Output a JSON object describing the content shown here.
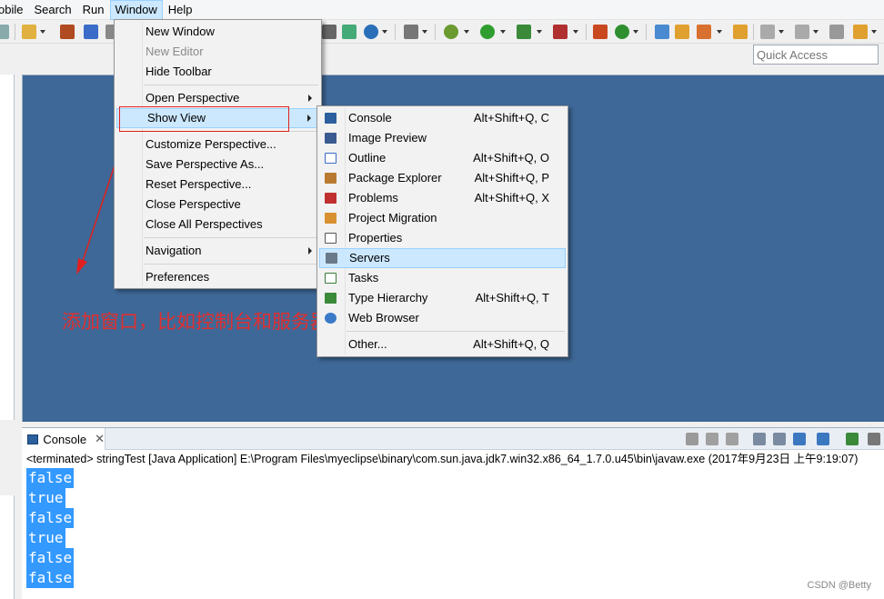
{
  "menubar": {
    "items": [
      "obile",
      "Search",
      "Run",
      "Window",
      "Help"
    ]
  },
  "quick_access": {
    "placeholder": "Quick Access"
  },
  "window_menu": {
    "new_window": "New Window",
    "new_editor": "New Editor",
    "hide_toolbar": "Hide Toolbar",
    "open_perspective": "Open Perspective",
    "show_view": "Show View",
    "customize_perspective": "Customize Perspective...",
    "save_perspective_as": "Save Perspective As...",
    "reset_perspective": "Reset Perspective...",
    "close_perspective": "Close Perspective",
    "close_all_perspectives": "Close All Perspectives",
    "navigation": "Navigation",
    "preferences": "Preferences"
  },
  "show_view_menu": {
    "items": [
      {
        "label": "Console",
        "shortcut": "Alt+Shift+Q, C",
        "icon": "console-icon"
      },
      {
        "label": "Image Preview",
        "shortcut": "",
        "icon": "image-preview-icon"
      },
      {
        "label": "Outline",
        "shortcut": "Alt+Shift+Q, O",
        "icon": "outline-icon"
      },
      {
        "label": "Package Explorer",
        "shortcut": "Alt+Shift+Q, P",
        "icon": "package-explorer-icon"
      },
      {
        "label": "Problems",
        "shortcut": "Alt+Shift+Q, X",
        "icon": "problems-icon"
      },
      {
        "label": "Project Migration",
        "shortcut": "",
        "icon": "project-migration-icon"
      },
      {
        "label": "Properties",
        "shortcut": "",
        "icon": "properties-icon"
      },
      {
        "label": "Servers",
        "shortcut": "",
        "icon": "servers-icon"
      },
      {
        "label": "Tasks",
        "shortcut": "",
        "icon": "tasks-icon"
      },
      {
        "label": "Type Hierarchy",
        "shortcut": "Alt+Shift+Q, T",
        "icon": "type-hierarchy-icon"
      },
      {
        "label": "Web Browser",
        "shortcut": "",
        "icon": "web-browser-icon"
      },
      {
        "label": "Other...",
        "shortcut": "Alt+Shift+Q, Q",
        "icon": ""
      }
    ]
  },
  "annotation": "添加窗口，比如控制台和服务器",
  "console": {
    "tab_label": "Console",
    "close_glyph": "✕",
    "status": "<terminated> stringTest [Java Application] E:\\Program Files\\myeclipse\\binary\\com.sun.java.jdk7.win32.x86_64_1.7.0.u45\\bin\\javaw.exe (2017年9月23日 上午9:19:07)",
    "output": [
      "false",
      "true",
      "false",
      "true",
      "false",
      "false"
    ]
  },
  "watermark": "CSDN @Betty",
  "colors": {
    "editor_bg": "#3e6897",
    "highlight": "#cce8ff",
    "selection": "#3399ff",
    "annotation": "#e03030"
  }
}
